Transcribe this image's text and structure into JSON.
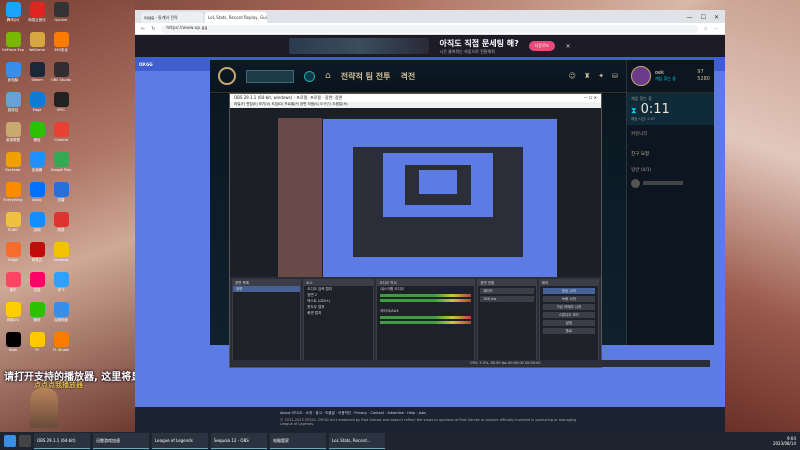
{
  "desktop": {
    "icons": [
      {
        "label": "腾讯QQ",
        "color": "#1aa3ff"
      },
      {
        "label": "网易云音乐",
        "color": "#e0241f"
      },
      {
        "label": "Quicker",
        "color": "#333"
      },
      {
        "label": "GeForce Experience",
        "color": "#76b900"
      },
      {
        "label": "WeGame",
        "color": "#d8a840"
      },
      {
        "label": "360安全",
        "color": "#ff7a00"
      },
      {
        "label": "此电脑",
        "color": "#3a8ee6"
      },
      {
        "label": "Steam",
        "color": "#1b2838"
      },
      {
        "label": "OBS Studio",
        "color": "#302e31"
      },
      {
        "label": "回收站",
        "color": "#6aa0d8"
      },
      {
        "label": "Edge",
        "color": "#0f7bd4"
      },
      {
        "label": "EPIC",
        "color": "#222"
      },
      {
        "label": "英雄联盟",
        "color": "#c8aa6e"
      },
      {
        "label": "微信",
        "color": "#2dc100"
      },
      {
        "label": "Chrome",
        "color": "#e84032"
      },
      {
        "label": "Rockstar",
        "color": "#f0a000"
      },
      {
        "label": "加速器",
        "color": "#1e90ff"
      },
      {
        "label": "Google Play",
        "color": "#34a853"
      },
      {
        "label": "Everything",
        "color": "#ff8a00"
      },
      {
        "label": "Uplay",
        "color": "#0070ff"
      },
      {
        "label": "迅雷",
        "color": "#2a6fd8"
      },
      {
        "label": "PUBG",
        "color": "#f0c040"
      },
      {
        "label": "战网",
        "color": "#148eff"
      },
      {
        "label": "网易",
        "color": "#d33"
      },
      {
        "label": "Origin",
        "color": "#f56c2d"
      },
      {
        "label": "网易云",
        "color": "#c20c0c"
      },
      {
        "label": "Sandbox",
        "color": "#f3c200"
      },
      {
        "label": "音乐",
        "color": "#ff4466"
      },
      {
        "label": "迅游",
        "color": "#f06"
      },
      {
        "label": "讯飞",
        "color": "#2ea0ff"
      },
      {
        "label": "网易UU",
        "color": "#ffcd00"
      },
      {
        "label": "微信",
        "color": "#2dc100"
      },
      {
        "label": "百度网盘",
        "color": "#3a8ee6"
      },
      {
        "label": "Kook",
        "color": "#000"
      },
      {
        "label": "YY",
        "color": "#ffc800"
      },
      {
        "label": "FL Studio",
        "color": "#ff7b00"
      }
    ],
    "lyric_main": "请打开支持的播放器, 这里将显示歌名",
    "lyric_sub": "点点点我播放器"
  },
  "browser": {
    "tabs": [
      "opgg - 통계와 전략",
      "LoL Stats, Record Replay, Guides"
    ],
    "url": "https://www.op.gg",
    "ad": {
      "headline": "아직도 직접 문세팅 해?",
      "sub": "시간 줄여줘는 자동으로 전환해줘",
      "button": "다운로드"
    },
    "opgg_label": "OP.GG",
    "footer_links": "About OP.GG · 소개 · 광고 · 도움말 · 이용약관 · Privacy · Contact · Advertise · Help · Jobs",
    "footer_text": "© 2012-2023 OP.GG. OP.GG isn't endorsed by Riot Games and doesn't reflect the views or opinions of Riot Games or anyone officially involved in producing or managing League of Legends."
  },
  "lol": {
    "nav": [
      "전략적 팀 전투",
      "격전"
    ],
    "username": "oek",
    "status": "게임 찾는 중",
    "currency_be": "97",
    "currency_rp": "5280",
    "queue_label": "게임 찾는 중",
    "timer": "0:11",
    "timer_sub": "예상 시간: 2:07",
    "side_section": "커뮤니티",
    "friends_header": "친구 요청",
    "friends_group": "일반 (0/1)"
  },
  "obs": {
    "title": "OBS 29.1.1 (64-bit, windows) - 프로필: 프로필 - 장면: 장면",
    "menu": "파일(F)  편집(E)  보기(V)  도킹(D)  프로필(P)  장면 모음(S)  도구(T)  도움말(H)",
    "docks": {
      "scenes": {
        "title": "장면 목록",
        "items": [
          "장면"
        ]
      },
      "sources": {
        "title": "소스",
        "items": [
          "오디오 입력 캡처",
          "장면 2",
          "텍스트 (GDI+)",
          "윈도우 캡처",
          "화면 캡처"
        ]
      },
      "mixer": {
        "title": "오디오 믹서",
        "items": [
          "데스크톱 오디오",
          "마이크/AUX"
        ]
      },
      "transitions": {
        "title": "장면 전환",
        "type": "페이드",
        "duration": "300 ms"
      },
      "controls": {
        "title": "제어",
        "buttons": [
          "방송 시작",
          "녹화 시작",
          "가상 카메라 시작",
          "스튜디오 모드",
          "설정",
          "종료"
        ]
      }
    },
    "status": "CPU: 3.5%, 60.00 fps  00:00:00  00:00:00"
  },
  "taskbar": {
    "items": [
      "OBS 29.1.1 (64-bit)",
      "迅雷游戏加速",
      "League of Legends",
      "Sequoia 12 - OBS",
      "电脑管家",
      "LoL Stats, Record..."
    ],
    "time": "9:04",
    "date": "2023/08/14"
  }
}
